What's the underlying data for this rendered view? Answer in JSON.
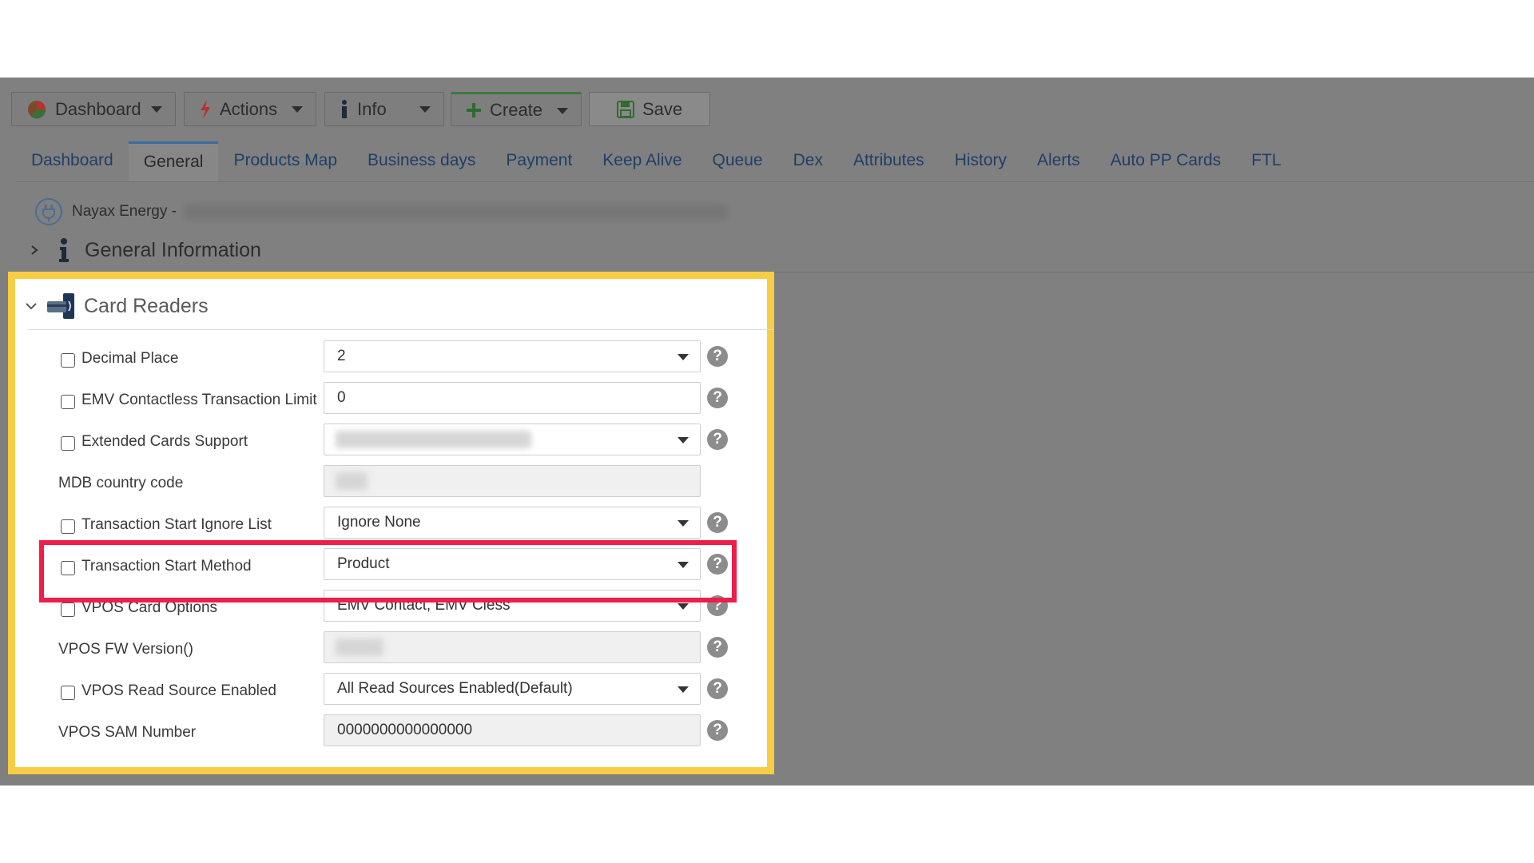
{
  "toolbar": {
    "dashboard_label": "Dashboard",
    "actions_label": "Actions",
    "info_label": "Info",
    "create_label": "Create",
    "save_label": "Save"
  },
  "tabs": [
    {
      "label": "Dashboard",
      "active": false
    },
    {
      "label": "General",
      "active": true
    },
    {
      "label": "Products Map",
      "active": false
    },
    {
      "label": "Business days",
      "active": false
    },
    {
      "label": "Payment",
      "active": false
    },
    {
      "label": "Keep Alive",
      "active": false
    },
    {
      "label": "Queue",
      "active": false
    },
    {
      "label": "Dex",
      "active": false
    },
    {
      "label": "Attributes",
      "active": false
    },
    {
      "label": "History",
      "active": false
    },
    {
      "label": "Alerts",
      "active": false
    },
    {
      "label": "Auto PP Cards",
      "active": false
    },
    {
      "label": "FTL",
      "active": false
    }
  ],
  "device": {
    "name_prefix": "Nayax Energy -"
  },
  "sections": {
    "general_information": "General Information",
    "card_readers": "Card Readers"
  },
  "card_readers": {
    "fields": [
      {
        "label": "Decimal Place",
        "value": "2",
        "type": "select"
      },
      {
        "label": "EMV Contactless Transaction Limit",
        "value": "0",
        "type": "text"
      },
      {
        "label": "Extended Cards Support",
        "value": "",
        "type": "select"
      },
      {
        "label": "MDB country code",
        "value": "",
        "type": "readonly"
      },
      {
        "label": "Transaction Start Ignore List",
        "value": "Ignore None",
        "type": "select"
      },
      {
        "label": "Transaction Start Method",
        "value": "Product",
        "type": "select"
      },
      {
        "label": "VPOS Card Options",
        "value": "EMV Contact, EMV Cless",
        "type": "select"
      },
      {
        "label": "VPOS FW Version()",
        "value": "",
        "type": "readonly"
      },
      {
        "label": "VPOS Read Source Enabled",
        "value": "All Read Sources Enabled(Default)",
        "type": "select"
      },
      {
        "label": "VPOS SAM Number",
        "value": "0000000000000000",
        "type": "readonly"
      }
    ],
    "help_glyph": "?"
  },
  "colors": {
    "panel_highlight": "#f7cd46",
    "field_highlight": "#ee1d4a",
    "tab_link": "#1f3f66"
  },
  "icons": {
    "dashboard": "pie-chart-icon",
    "actions": "lightning-icon",
    "info": "info-icon",
    "create": "plus-icon",
    "save": "floppy-disk-icon",
    "device": "power-plug-icon",
    "card_readers": "card-reader-icon"
  }
}
